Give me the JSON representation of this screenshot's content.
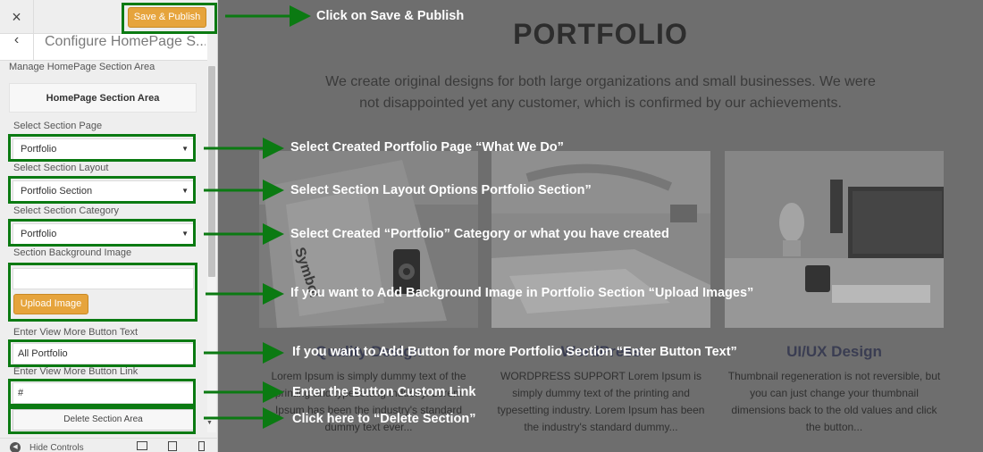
{
  "panel": {
    "close_icon": "×",
    "save_label": "Save & Publish",
    "back_icon": "‹",
    "title": "Configure HomePage S...",
    "manage_label": "Manage HomePage Section Area",
    "section_title": "HomePage Section Area",
    "fields": {
      "page_label": "Select Section Page",
      "page_value": "Portfolio",
      "layout_label": "Select Section Layout",
      "layout_value": "Portfolio Section",
      "category_label": "Select Section Category",
      "category_value": "Portfolio",
      "bg_label": "Section Background Image",
      "upload_label": "Upload Image",
      "btn_text_label": "Enter View More Button Text",
      "btn_text_value": "All Portfolio",
      "btn_link_label": "Enter View More Button Link",
      "btn_link_value": "#",
      "delete_label": "Delete Section Area"
    },
    "footer": {
      "hide_label": "Hide Controls"
    },
    "caret": "▼",
    "scroll_down": "▼"
  },
  "preview": {
    "title": "PORTFOLIO",
    "subtitle": "We create original designs for both large organizations and small businesses. We were not disappointed yet any customer, which is confirmed by our achievements.",
    "cards": [
      {
        "title": "Quality Design",
        "text": "Lorem Ipsum is simply dummy text of the printing and typesetting industry. Lorem Ipsum has been the industry's standard dummy text ever..."
      },
      {
        "title": "WordPress",
        "text": "WORDPRESS SUPPORT Lorem Ipsum is simply dummy text of the printing and typesetting industry. Lorem Ipsum has been the industry's standard dummy..."
      },
      {
        "title": "UI/UX Design",
        "text": "Thumbnail regeneration is not reversible, but you can just change your thumbnail dimensions back to the old values and click the button..."
      }
    ]
  },
  "annotations": {
    "save": "Click on Save & Publish",
    "page": "Select Created Portfolio Page “What We Do”",
    "layout": "Select Section Layout Options Portfolio Section”",
    "category": "Select Created “Portfolio” Category or what you have created",
    "bg": "If you want to Add Background Image in Portfolio Section “Upload Images”",
    "btn_text": "If you want to Add Button for more  Portfolio Section “Enter Button Text”",
    "btn_link": "Enter the Button Custom Link",
    "delete": "Click here to “Delete Section”"
  },
  "colors": {
    "highlight_green": "#0b7a12",
    "save_button": "#e6a43c",
    "annotation_text": "#ffffff"
  }
}
